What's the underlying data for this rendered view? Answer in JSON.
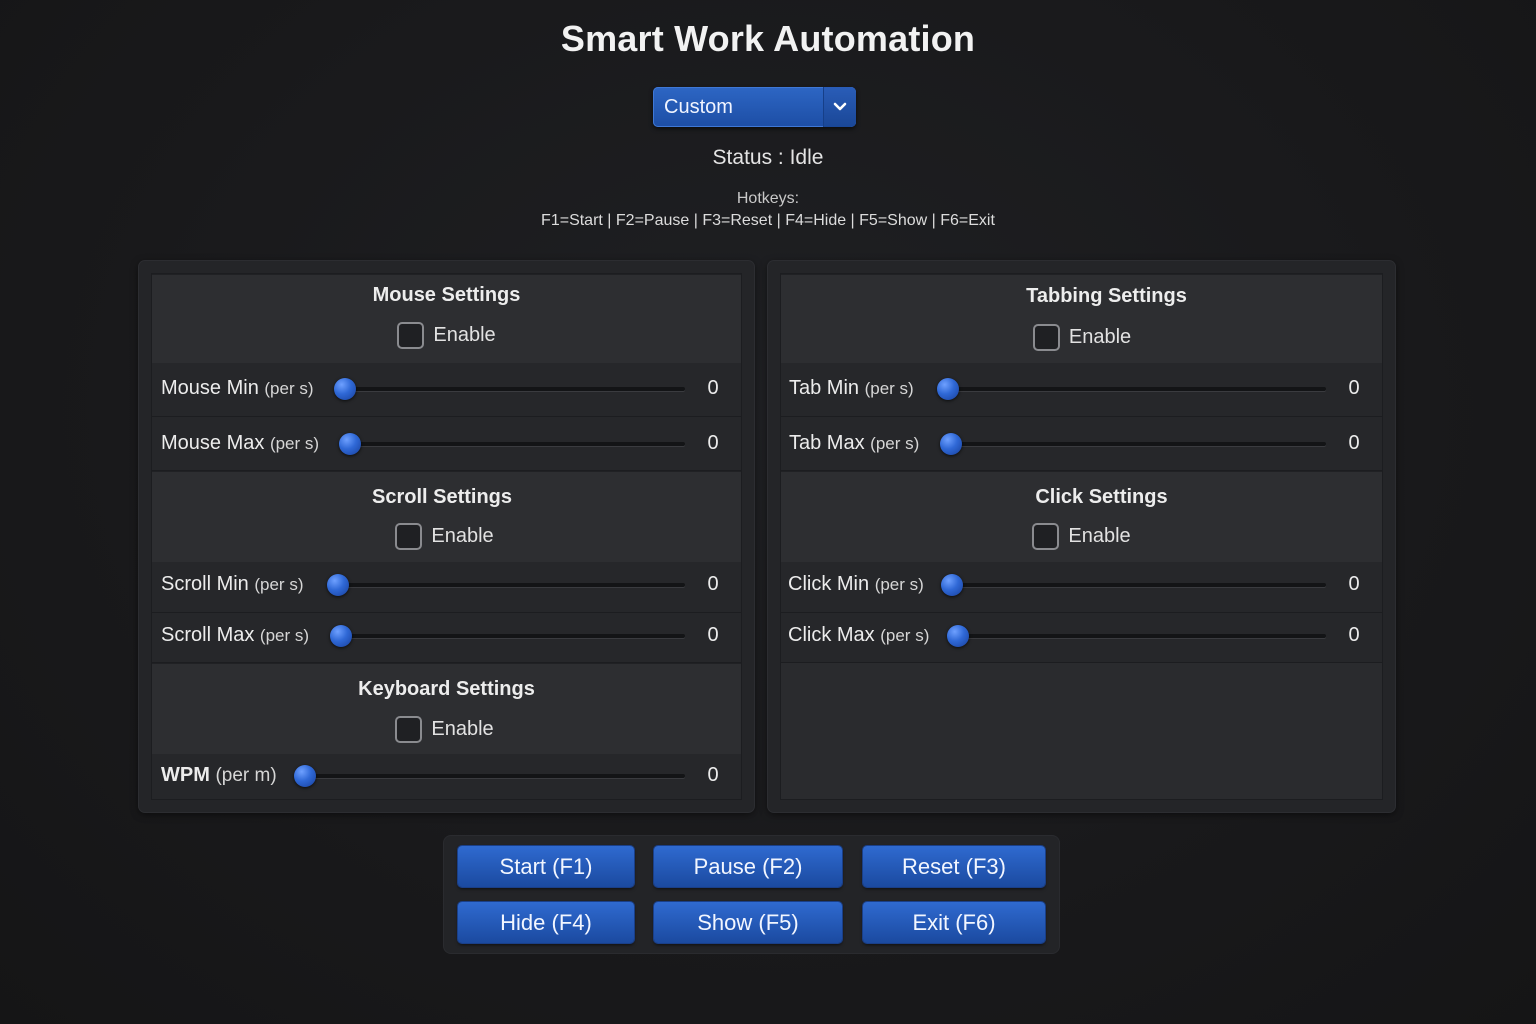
{
  "app": {
    "title": "Smart Work Automation"
  },
  "profile": {
    "selected": "Custom"
  },
  "status": {
    "text": "Status : Idle"
  },
  "hotkeys": {
    "label": "Hotkeys:",
    "list": "F1=Start | F2=Pause | F3=Reset | F4=Hide | F5=Show | F6=Exit"
  },
  "mouse": {
    "title": "Mouse Settings",
    "enable_label": "Enable",
    "enabled": false,
    "min": {
      "label": "Mouse Min",
      "unit": "(per s)",
      "value": "0"
    },
    "max": {
      "label": "Mouse Max",
      "unit": "(per s)",
      "value": "0"
    }
  },
  "scroll": {
    "title": "Scroll Settings",
    "enable_label": "Enable",
    "enabled": false,
    "min": {
      "label": "Scroll Min",
      "unit": "(per s)",
      "value": "0"
    },
    "max": {
      "label": "Scroll Max",
      "unit": "(per s)",
      "value": "0"
    }
  },
  "keyboard": {
    "title": "Keyboard Settings",
    "enable_label": "Enable",
    "enabled": false,
    "wpm": {
      "label": "WPM",
      "unit": "(per m)",
      "value": "0"
    }
  },
  "tabbing": {
    "title": "Tabbing Settings",
    "enable_label": "Enable",
    "enabled": false,
    "min": {
      "label": "Tab Min",
      "unit": "(per s)",
      "value": "0"
    },
    "max": {
      "label": "Tab Max",
      "unit": "(per s)",
      "value": "0"
    }
  },
  "click": {
    "title": "Click Settings",
    "enable_label": "Enable",
    "enabled": false,
    "min": {
      "label": "Click Min",
      "unit": "(per s)",
      "value": "0"
    },
    "max": {
      "label": "Click Max",
      "unit": "(per s)",
      "value": "0"
    }
  },
  "buttons": {
    "start": "Start (F1)",
    "pause": "Pause (F2)",
    "reset": "Reset (F3)",
    "hide": "Hide (F4)",
    "show": "Show (F5)",
    "exit": "Exit (F6)"
  },
  "colors": {
    "accent": "#2a5fc0",
    "background": "#1a1b1e",
    "panel": "#2a2b2e"
  },
  "icons": {
    "dropdown": "chevron-down-icon"
  }
}
